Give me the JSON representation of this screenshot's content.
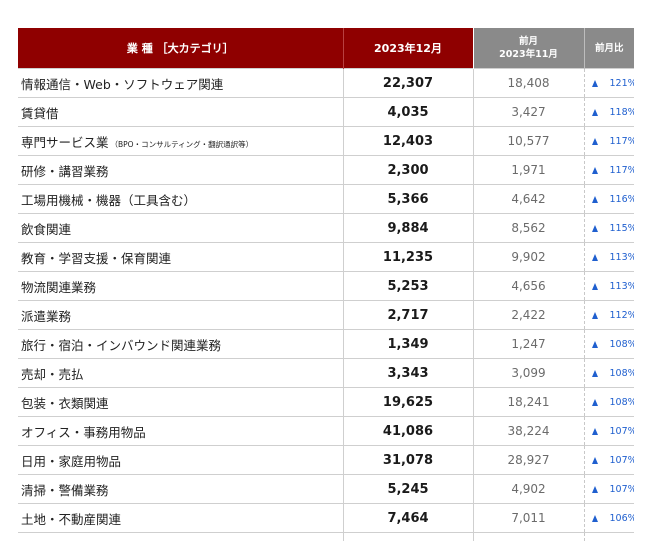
{
  "header": {
    "category": "業 種 ［大カテゴリ］",
    "current": "2023年12月",
    "prev_line1": "前月",
    "prev_line2": "2023年11月",
    "ratio": "前月比"
  },
  "colors": {
    "header_red": "#8f0000",
    "header_gray": "#8a8a8a",
    "arrow_blue": "#1f5fcf"
  },
  "icons": {
    "up_arrow": "triangle-up-icon"
  },
  "rows": [
    {
      "category": "情報通信・Web・ソフトウェア関連",
      "note": "",
      "current": "22,307",
      "previous": "18,408",
      "ratio": "121%"
    },
    {
      "category": "賃貸借",
      "note": "",
      "current": "4,035",
      "previous": "3,427",
      "ratio": "118%"
    },
    {
      "category": "専門サービス業",
      "note": "（BPO・コンサルティング・翻訳通訳等）",
      "current": "12,403",
      "previous": "10,577",
      "ratio": "117%"
    },
    {
      "category": "研修・講習業務",
      "note": "",
      "current": "2,300",
      "previous": "1,971",
      "ratio": "117%"
    },
    {
      "category": "工場用機械・機器（工具含む）",
      "note": "",
      "current": "5,366",
      "previous": "4,642",
      "ratio": "116%"
    },
    {
      "category": "飲食関連",
      "note": "",
      "current": "9,884",
      "previous": "8,562",
      "ratio": "115%"
    },
    {
      "category": "教育・学習支援・保育関連",
      "note": "",
      "current": "11,235",
      "previous": "9,902",
      "ratio": "113%"
    },
    {
      "category": "物流関連業務",
      "note": "",
      "current": "5,253",
      "previous": "4,656",
      "ratio": "113%"
    },
    {
      "category": "派遣業務",
      "note": "",
      "current": "2,717",
      "previous": "2,422",
      "ratio": "112%"
    },
    {
      "category": "旅行・宿泊・インバウンド関連業務",
      "note": "",
      "current": "1,349",
      "previous": "1,247",
      "ratio": "108%"
    },
    {
      "category": "売却・売払",
      "note": "",
      "current": "3,343",
      "previous": "3,099",
      "ratio": "108%"
    },
    {
      "category": "包装・衣類関連",
      "note": "",
      "current": "19,625",
      "previous": "18,241",
      "ratio": "108%"
    },
    {
      "category": "オフィス・事務用物品",
      "note": "",
      "current": "41,086",
      "previous": "38,224",
      "ratio": "107%"
    },
    {
      "category": "日用・家庭用物品",
      "note": "",
      "current": "31,078",
      "previous": "28,927",
      "ratio": "107%"
    },
    {
      "category": "清掃・警備業務",
      "note": "",
      "current": "5,245",
      "previous": "4,902",
      "ratio": "107%"
    },
    {
      "category": "土地・不動産関連",
      "note": "",
      "current": "7,464",
      "previous": "7,011",
      "ratio": "106%"
    }
  ]
}
